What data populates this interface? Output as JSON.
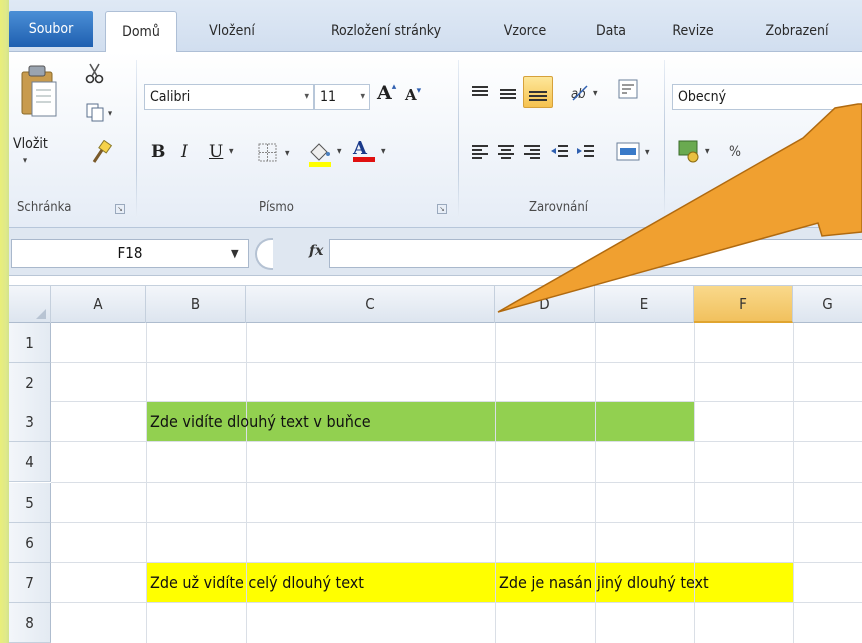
{
  "tabs": {
    "file": "Soubor",
    "home": "Domů",
    "insert": "Vložení",
    "page_layout": "Rozložení stránky",
    "formulas": "Vzorce",
    "data": "Data",
    "review": "Revize",
    "view": "Zobrazení"
  },
  "ribbon": {
    "clipboard": {
      "paste_label": "Vložit",
      "group_label": "Schránka"
    },
    "font": {
      "font_name": "Calibri",
      "font_size": "11",
      "bold": "B",
      "italic": "I",
      "underline": "U",
      "font_color_letter": "A",
      "grow_letter": "A",
      "shrink_letter": "A",
      "group_label": "Písmo"
    },
    "alignment": {
      "group_label": "Zarovnání"
    },
    "number": {
      "format": "Obecný"
    }
  },
  "formula_bar": {
    "name_box": "F18",
    "fx": "fx",
    "formula": ""
  },
  "grid": {
    "columns": [
      "A",
      "B",
      "C",
      "D",
      "E",
      "F",
      "G"
    ],
    "active_column": "F",
    "rows": [
      "1",
      "2",
      "3",
      "4",
      "5",
      "6",
      "7",
      "8"
    ],
    "cells": {
      "B3": "Zde vidíte dlouhý text v buňce",
      "B7": "Zde už vidíte celý dlouhý text",
      "D7": "Zde je nasán jiný dlouhý text"
    },
    "fill_colors": {
      "B3_F3": "#92d050",
      "B7_D7": "#ffff00"
    }
  },
  "callout_color": "#f0a030"
}
